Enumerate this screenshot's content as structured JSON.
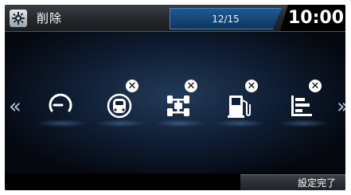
{
  "header": {
    "title": "削除",
    "page_indicator": "12/15",
    "clock": "10:00",
    "title_icon": "gear-icon"
  },
  "navigation": {
    "prev_arrow": "«",
    "next_arrow": "»"
  },
  "slots": [
    {
      "icon": "trip-computer-icon",
      "removable": false
    },
    {
      "icon": "vehicle-assist-icon",
      "removable": true,
      "remove_glyph": "✕"
    },
    {
      "icon": "tire-pressure-icon",
      "removable": true,
      "remove_glyph": "✕"
    },
    {
      "icon": "fuel-economy-icon",
      "removable": true,
      "remove_glyph": "✕"
    },
    {
      "icon": "history-bars-icon",
      "removable": true,
      "remove_glyph": "✕"
    }
  ],
  "footer": {
    "done_label": "設定完了"
  },
  "colors": {
    "accent_blue": "#1d5a93",
    "background": "#000000",
    "icon": "#ffffff"
  }
}
